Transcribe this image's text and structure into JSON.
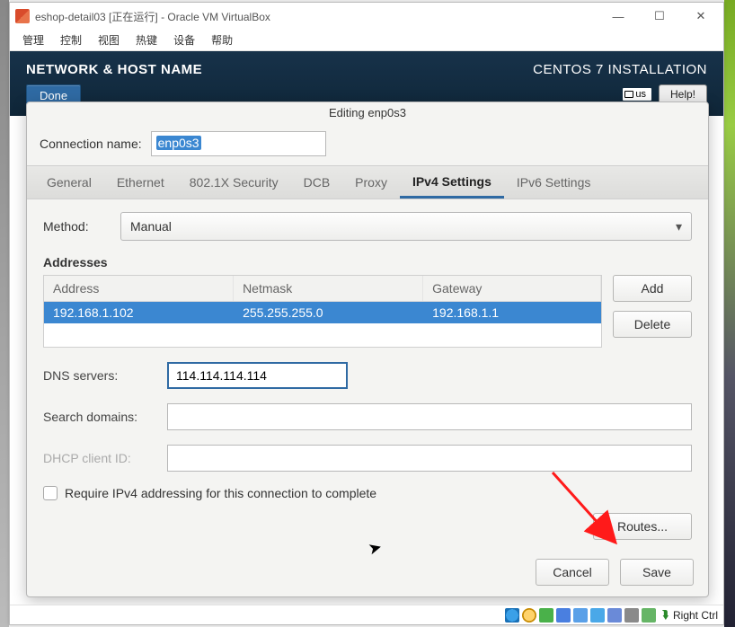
{
  "virtualbox": {
    "window_title": "eshop-detail03 [正在运行] - Oracle VM VirtualBox",
    "menu": [
      "管理",
      "控制",
      "视图",
      "热键",
      "设备",
      "帮助"
    ],
    "win_min": "—",
    "win_max": "☐",
    "win_close": "✕",
    "status_hostkey_arrow": "⮯",
    "status_hostkey": "Right Ctrl"
  },
  "anaconda": {
    "header_title": "NETWORK & HOST NAME",
    "done": "Done",
    "install_title": "CENTOS 7 INSTALLATION",
    "kb": "us",
    "help": "Help!"
  },
  "dialog": {
    "title": "Editing enp0s3",
    "conn_name_label": "Connection name:",
    "conn_name_value": "enp0s3",
    "tabs": {
      "general": "General",
      "ethernet": "Ethernet",
      "security": "802.1X Security",
      "dcb": "DCB",
      "proxy": "Proxy",
      "ipv4": "IPv4 Settings",
      "ipv6": "IPv6 Settings"
    },
    "method_label": "Method:",
    "method_value": "Manual",
    "addresses_title": "Addresses",
    "addr_headers": {
      "address": "Address",
      "netmask": "Netmask",
      "gateway": "Gateway"
    },
    "addr_row": {
      "address": "192.168.1.102",
      "netmask": "255.255.255.0",
      "gateway": "192.168.1.1"
    },
    "btn_add": "Add",
    "btn_delete": "Delete",
    "dns_label": "DNS servers:",
    "dns_value": "114.114.114.114",
    "search_label": "Search domains:",
    "search_value": "",
    "dhcp_label": "DHCP client ID:",
    "dhcp_value": "",
    "require_label": "Require IPv4 addressing for this connection to complete",
    "routes": "Routes...",
    "cancel": "Cancel",
    "save": "Save"
  }
}
